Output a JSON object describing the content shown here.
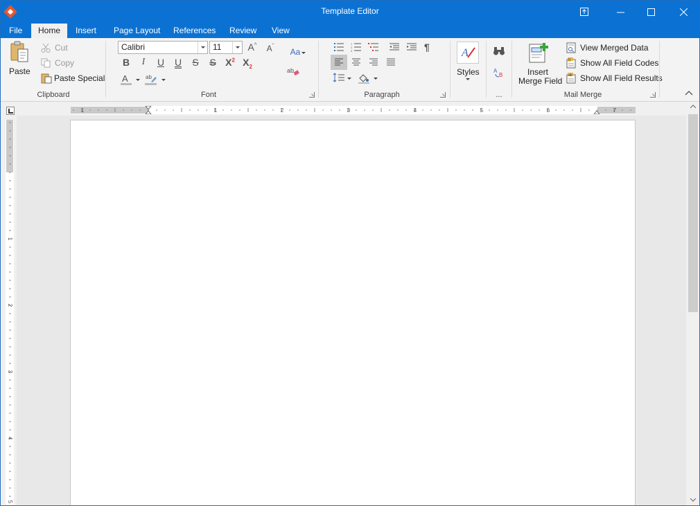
{
  "window": {
    "title": "Template Editor",
    "controls": [
      "ribbon-display-icon",
      "minimize-icon",
      "maximize-icon",
      "close-icon"
    ]
  },
  "tabs": [
    {
      "label": "File"
    },
    {
      "label": "Home",
      "active": true
    },
    {
      "label": "Insert"
    },
    {
      "label": "Page Layout"
    },
    {
      "label": "References"
    },
    {
      "label": "Review"
    },
    {
      "label": "View"
    }
  ],
  "ribbon": {
    "clipboard": {
      "label": "Clipboard",
      "paste": "Paste",
      "cut": "Cut",
      "copy": "Copy",
      "paste_special": "Paste Special"
    },
    "font": {
      "label": "Font",
      "family": "Calibri",
      "size": "11",
      "bold": "B",
      "italic": "I",
      "underline": "U",
      "double_underline": "U",
      "strike": "S",
      "double_strike": "S",
      "superscript": "X",
      "subscript": "X",
      "change_case": "Aa",
      "grow": "A",
      "shrink": "A"
    },
    "paragraph": {
      "label": "Paragraph"
    },
    "styles": {
      "label": "Styles"
    },
    "editing": {
      "label": "..."
    },
    "mail_merge": {
      "label": "Mail Merge",
      "insert_merge_field_1": "Insert",
      "insert_merge_field_2": "Merge Field",
      "view_merged_data": "View Merged Data",
      "show_all_field_codes": "Show All Field Codes",
      "show_all_field_results": "Show All Field Results"
    }
  },
  "ruler": {
    "h_numbers": [
      "1",
      "1",
      "2",
      "3",
      "4",
      "5",
      "6",
      "7"
    ],
    "v_numbers": [
      "1",
      "2",
      "3",
      "4",
      "5"
    ]
  },
  "colors": {
    "title_bar": "#0b72d3",
    "ribbon": "#f3f3f3",
    "workspace": "#e8e8e8",
    "page": "#ffffff"
  }
}
